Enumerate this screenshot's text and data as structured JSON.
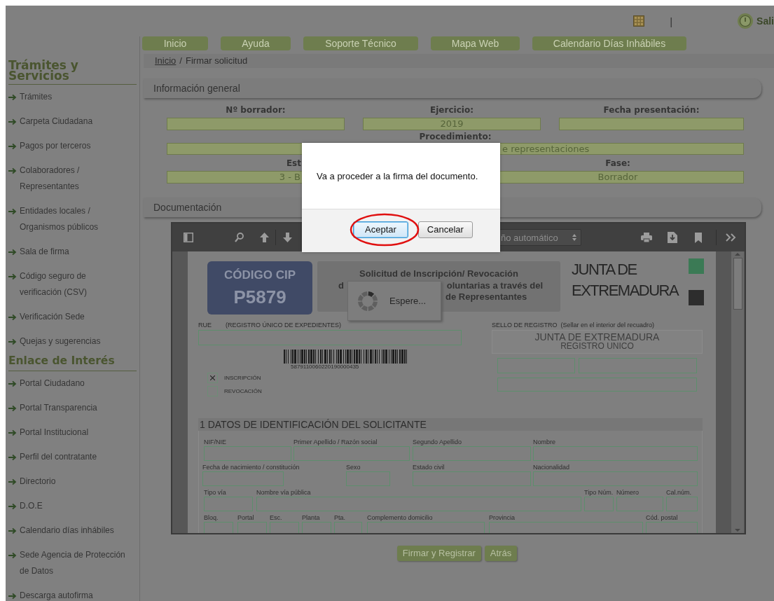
{
  "header": {
    "separator": "|",
    "exit": "Sali"
  },
  "nav": [
    {
      "label": "Inicio"
    },
    {
      "label": "Ayuda"
    },
    {
      "label": "Soporte Técnico"
    },
    {
      "label": "Mapa Web"
    },
    {
      "label": "Calendario Días Inhábiles"
    }
  ],
  "breadcrumb": {
    "link": "Inicio",
    "separator": "/",
    "current": "Firmar solicitud"
  },
  "sidebar": [
    {
      "title": "Trámites y Servicios",
      "items": [
        "Trámites",
        "Carpeta Ciudadana",
        "Pagos por terceros",
        "Colaboradores / Representantes",
        "Entidades locales / Organismos públicos",
        "Sala de firma",
        "Código seguro de verificación (CSV)",
        "Verificación Sede",
        "Quejas y sugerencias"
      ]
    },
    {
      "title": "Enlace de Interés",
      "items": [
        "Portal Ciudadano",
        "Portal Transparencia",
        "Portal Institucional",
        "Perfil del contratante",
        "Directorio",
        "D.O.E",
        "Calendario días inhábiles",
        "Sede Agencia de Protección de Datos",
        "Descarga autofirma"
      ]
    }
  ],
  "general_info": {
    "title": "Información general",
    "fields": [
      {
        "label": "Nº borrador:"
      },
      {
        "label": "Ejercicio:",
        "value": "2019"
      },
      {
        "label": "Fecha presentación:"
      },
      {
        "label": "Procedimiento:",
        "value": "e representaciones"
      },
      {
        "label": "Est",
        "value": "3 - B"
      },
      {
        "label": "Fase:",
        "value": "Borrador"
      }
    ]
  },
  "documentation": {
    "title": "Documentación"
  },
  "viewer": {
    "zoom": "ño automático",
    "page": {
      "cip_label": "CÓDIGO CIP",
      "cip_code": "P5879",
      "title_lines": [
        [
          "Solicitud de Inscripción/ Revocación"
        ],
        [
          "d",
          "oluntarias a través del"
        ],
        [
          "de Representantes"
        ]
      ],
      "logo": [
        "JUNTA DE",
        "EXTREMADURA"
      ],
      "rue_label": "RUE",
      "rue_caption": "(REGISTRO ÚNICO DE EXPEDIENTES)",
      "barcode_number": "5879110060220190000435",
      "checkboxes": [
        {
          "label": "INSCRIPCIÓN",
          "checked": true
        },
        {
          "label": "REVOCACIÓN",
          "checked": false
        }
      ],
      "seal_label": "SELLO DE REGISTRO",
      "seal_note": "(Sellar en el interior del recuadro)",
      "stamp": [
        "JUNTA DE EXTREMADURA",
        "REGISTRO UNICO"
      ],
      "section_title": "1 DATOS DE IDENTIFICACIÓN DEL SOLICITANTE",
      "form_rows": [
        [
          "NIF/NIE",
          "Primer Apellido / Razón social",
          "Segundo Apellido",
          "Nombre"
        ],
        [
          "Fecha de nacimiento / constitución",
          "Sexo",
          "Estado civil",
          "Nacionalidad"
        ],
        [
          "Tipo vía",
          "Nombre vía pública",
          "Tipo Núm.",
          "Número",
          "Cal.núm."
        ],
        [
          "Bloq.",
          "Portal",
          "Esc.",
          "Planta",
          "Pta.",
          "Complemento domicilio",
          "Provincia",
          "Cód. postal"
        ]
      ]
    }
  },
  "loading": {
    "text": "Espere..."
  },
  "actions": [
    "Firmar y Registrar",
    "Atrás"
  ],
  "dialog": {
    "message": "Va a proceder a la firma del documento.",
    "buttons": [
      {
        "label": "Aceptar",
        "focused": true,
        "circled": true
      },
      {
        "label": "Cancelar",
        "focused": false,
        "circled": false
      }
    ]
  }
}
